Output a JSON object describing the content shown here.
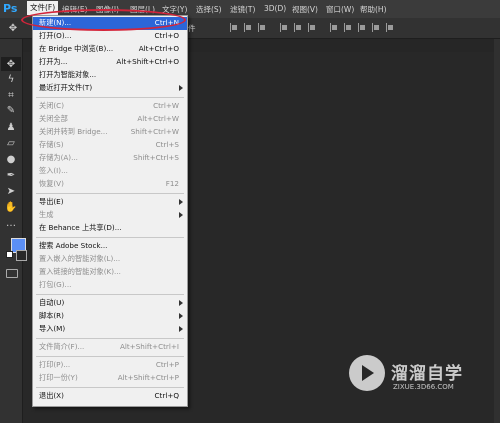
{
  "app": {
    "logo_text": "Ps"
  },
  "menubar": {
    "items": [
      "文件(F)",
      "编辑(E)",
      "图像(I)",
      "图层(L)",
      "文字(Y)",
      "选择(S)",
      "滤镜(T)",
      "3D(D)",
      "视图(V)",
      "窗口(W)",
      "帮助(H)"
    ]
  },
  "optionsbar": {
    "trailing_text": "件"
  },
  "file_menu": {
    "items": [
      {
        "label": "新建(N)...",
        "shortcut": "Ctrl+N",
        "state": "highlighted"
      },
      {
        "label": "打开(O)...",
        "shortcut": "Ctrl+O",
        "state": "enabled"
      },
      {
        "label": "在 Bridge 中浏览(B)...",
        "shortcut": "Alt+Ctrl+O",
        "state": "enabled"
      },
      {
        "label": "打开为...",
        "shortcut": "Alt+Shift+Ctrl+O",
        "state": "enabled"
      },
      {
        "label": "打开为智能对象...",
        "shortcut": "",
        "state": "enabled"
      },
      {
        "label": "最近打开文件(T)",
        "shortcut": "",
        "state": "enabled",
        "submenu": true
      },
      {
        "label": "关闭(C)",
        "shortcut": "Ctrl+W",
        "state": "disabled"
      },
      {
        "label": "关闭全部",
        "shortcut": "Alt+Ctrl+W",
        "state": "disabled"
      },
      {
        "label": "关闭并转到 Bridge...",
        "shortcut": "Shift+Ctrl+W",
        "state": "disabled"
      },
      {
        "label": "存储(S)",
        "shortcut": "Ctrl+S",
        "state": "disabled"
      },
      {
        "label": "存储为(A)...",
        "shortcut": "Shift+Ctrl+S",
        "state": "disabled"
      },
      {
        "label": "签入(I)...",
        "shortcut": "",
        "state": "disabled"
      },
      {
        "label": "恢复(V)",
        "shortcut": "F12",
        "state": "disabled"
      },
      {
        "label": "导出(E)",
        "shortcut": "",
        "state": "enabled",
        "submenu": true
      },
      {
        "label": "生成",
        "shortcut": "",
        "state": "disabled",
        "submenu": true
      },
      {
        "label": "在 Behance 上共享(D)...",
        "shortcut": "",
        "state": "enabled"
      },
      {
        "label": "搜索 Adobe Stock...",
        "shortcut": "",
        "state": "enabled"
      },
      {
        "label": "置入嵌入的智能对象(L)...",
        "shortcut": "",
        "state": "disabled"
      },
      {
        "label": "置入链接的智能对象(K)...",
        "shortcut": "",
        "state": "disabled"
      },
      {
        "label": "打包(G)...",
        "shortcut": "",
        "state": "disabled"
      },
      {
        "label": "自动(U)",
        "shortcut": "",
        "state": "enabled",
        "submenu": true
      },
      {
        "label": "脚本(R)",
        "shortcut": "",
        "state": "enabled",
        "submenu": true
      },
      {
        "label": "导入(M)",
        "shortcut": "",
        "state": "enabled",
        "submenu": true
      },
      {
        "label": "文件简介(F)...",
        "shortcut": "Alt+Shift+Ctrl+I",
        "state": "disabled"
      },
      {
        "label": "打印(P)...",
        "shortcut": "Ctrl+P",
        "state": "disabled"
      },
      {
        "label": "打印一份(Y)",
        "shortcut": "Alt+Shift+Ctrl+P",
        "state": "disabled"
      },
      {
        "label": "退出(X)",
        "shortcut": "Ctrl+Q",
        "state": "enabled"
      }
    ]
  },
  "colors": {
    "foreground": "#5b8ff5",
    "highlight": "#2c66d8",
    "annotation": "#d3243a"
  },
  "watermark": {
    "title": "溜溜自学",
    "subtitle": "ZIXUE.3D66.COM"
  }
}
